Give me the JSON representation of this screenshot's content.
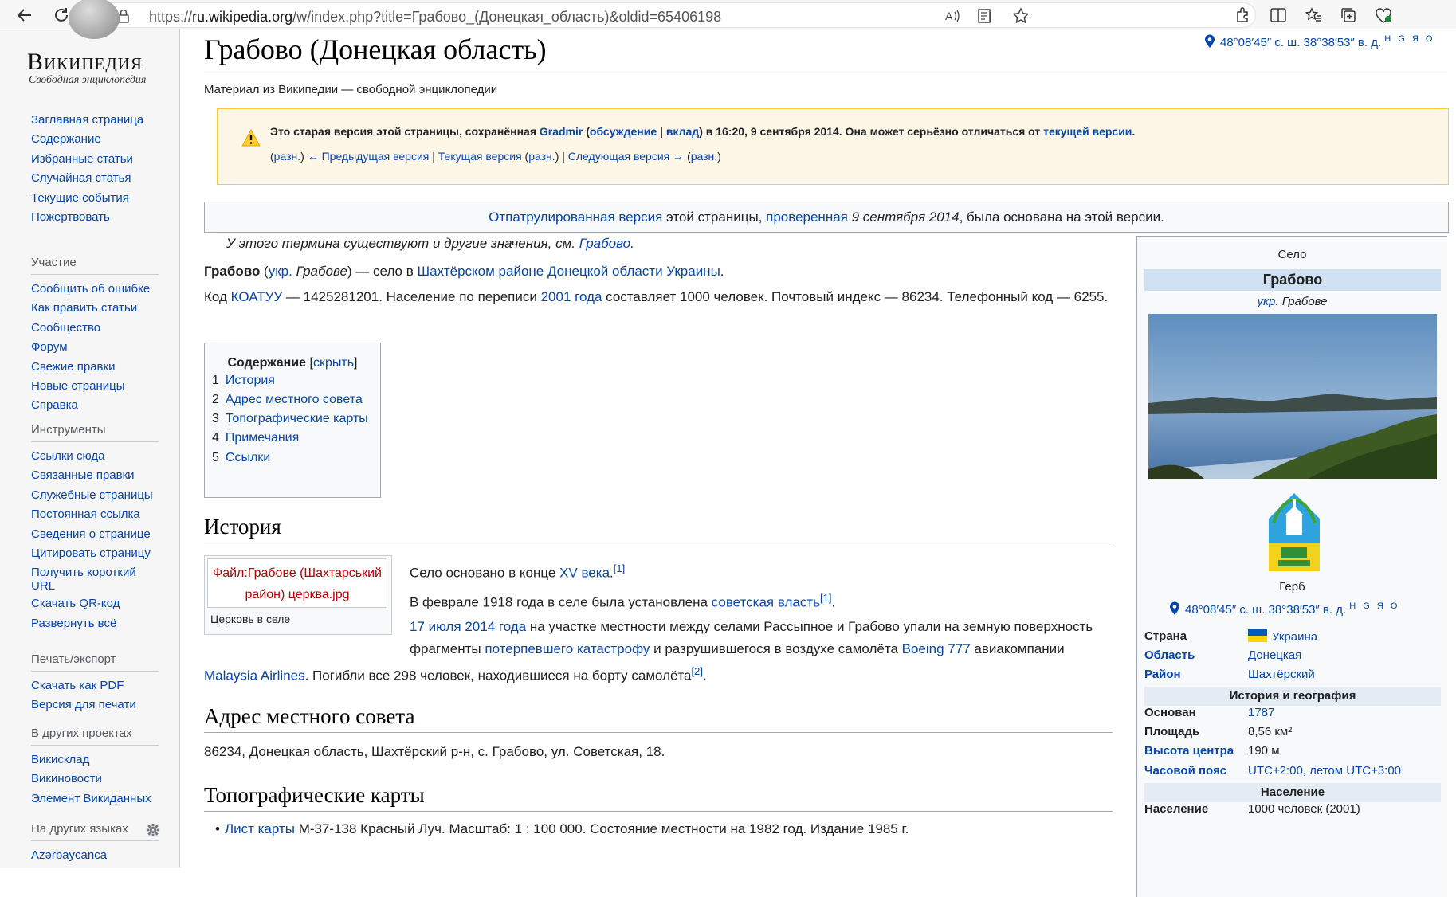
{
  "browser": {
    "url_prefix": "https://",
    "url_host": "ru.wikipedia.org",
    "url_rest": "/w/index.php?title=Грабово_(Донецкая_область)&oldid=65406198"
  },
  "logo": {
    "wordmark": "Википедия",
    "tagline": "Свободная энциклопедия"
  },
  "sidebar": {
    "main": [
      "Заглавная страница",
      "Содержание",
      "Избранные статьи",
      "Случайная статья",
      "Текущие события",
      "Пожертвовать"
    ],
    "participation": {
      "heading": "Участие",
      "items": [
        "Сообщить об ошибке",
        "Как править статьи",
        "Сообщество",
        "Форум",
        "Свежие правки",
        "Новые страницы",
        "Справка"
      ]
    },
    "tools": {
      "heading": "Инструменты",
      "items": [
        "Ссылки сюда",
        "Связанные правки",
        "Служебные страницы",
        "Постоянная ссылка",
        "Сведения о странице",
        "Цитировать страницу",
        "Получить короткий URL",
        "Скачать QR-код",
        "Развернуть всё"
      ]
    },
    "print": {
      "heading": "Печать/экспорт",
      "items": [
        "Скачать как PDF",
        "Версия для печати"
      ]
    },
    "projects": {
      "heading": "В других проектах",
      "items": [
        "Викисклад",
        "Викиновости",
        "Элемент Викиданных"
      ]
    },
    "languages": {
      "heading": "На других языках",
      "items": [
        "Azərbaycanca"
      ]
    }
  },
  "article": {
    "title": "Грабово (Донецкая область)",
    "sitesub": "Материал из Википедии — свободной энциклопедии",
    "coords": "48°08′45″ с. ш. 38°38′53″ в. д.",
    "coords_links": "H G Я O",
    "oldrev": {
      "t1": "Это старая версия этой страницы, сохранённая ",
      "user": "Gradmir",
      "t2": " (",
      "talk": "обсуждение",
      "sep": " | ",
      "contribs": "вклад",
      "t3": ") в 16:20, 9 сентября 2014. Она может серьёзно отличаться от ",
      "current": "текущей версии",
      "t4": ".",
      "nav": {
        "p_open": "(",
        "diff1": "разн.",
        "p_close": ") ",
        "prev": "← Предыдущая версия",
        "bar1": " | ",
        "cur": "Текущая версия",
        "p_open2": " (",
        "diff2": "разн.",
        "p_close2": ") | ",
        "next": "Следующая версия →",
        "p_open3": " (",
        "diff3": "разн.",
        "p_close3": ")"
      }
    },
    "patrol": {
      "link1": "Отпатрулированная версия",
      "t1": " этой страницы, ",
      "link2": "проверенная",
      "date": " 9 сентября 2014",
      "t2": ", была основана на этой версии."
    },
    "hatnote": {
      "t": "У этого термина существуют и другие значения, см. ",
      "link": "Грабово",
      "end": "."
    },
    "intro": {
      "bold": "Грабово",
      "t1": " (",
      "ukr": "укр.",
      "ukrname": " Грабове",
      "t2": ") — село в ",
      "link": "Шахтёрском районе Донецкой области Украины",
      "t3": "."
    },
    "intro2": {
      "t1": "Код ",
      "koatuu": "КОАТУУ",
      "t2": " — 1425281201. Население по переписи ",
      "year": "2001 года",
      "t3": " составляет 1000 человек. Почтовый индекс — 86234. Телефонный код — 6255."
    },
    "toc": {
      "title": "Содержание",
      "hide_open": " [",
      "hide": "скрыть",
      "hide_close": "]",
      "items": [
        {
          "num": "1",
          "label": "История"
        },
        {
          "num": "2",
          "label": "Адрес местного совета"
        },
        {
          "num": "3",
          "label": "Топографические карты"
        },
        {
          "num": "4",
          "label": "Примечания"
        },
        {
          "num": "5",
          "label": "Ссылки"
        }
      ]
    },
    "history": {
      "heading": "История",
      "thumb_link": "Файл:Грабове (Шахтарський район) церква.jpg",
      "thumb_caption": "Церковь в селе",
      "s1a": "Село основано в конце ",
      "s1link": "XV века",
      "s1end": ".",
      "ref1": "[1]",
      "s2a": "В феврале 1918 года в селе была установлена ",
      "s2link": "советская власть",
      "ref1b": "[1]",
      "s2end": ".",
      "s3date": "17 июля 2014 года",
      "s3a": " на участке местности между селами Рассыпное и Грабово упали на земную поверхность",
      "s3b": "фрагменты ",
      "s3link": "потерпевшего катастрофу",
      "s3c": " и разрушившегося в воздухе самолёта ",
      "boeing": "Boeing 777",
      "s3d": " авиакомпании",
      "malaysia": "Malaysia Airlines",
      "s3e": ". Погибли все 298 человек, находившиеся на борту самолёта",
      "ref2": "[2]",
      "s3end": "."
    },
    "council": {
      "heading": "Адрес местного совета",
      "text": "86234, Донецкая область, Шахтёрский р-н, с. Грабово, ул. Советская, 18."
    },
    "maps": {
      "heading": "Топографические карты",
      "bullet": "•",
      "link": "Лист карты",
      "text": " M-37-138 Красный Луч. Масштаб: 1 : 100 000. Состояние местности на 1982 год. Издание 1985 г."
    }
  },
  "infobox": {
    "above": "Село",
    "name": "Грабово",
    "native_prefix": "укр.",
    "native_name": " Грабове",
    "coa_caption": "Герб",
    "coords": "48°08′45″ с. ш. 38°38′53″ в. д.",
    "coords_links": "H G Я O",
    "rows1": [
      {
        "k": "Страна",
        "v": "Украина"
      },
      {
        "k": "Область",
        "v": "Донецкая"
      },
      {
        "k": "Район",
        "v": "Шахтёрский"
      }
    ],
    "sec1": "История и география",
    "rows2": [
      {
        "k": "Основан",
        "v": "1787"
      },
      {
        "k": "Площадь",
        "v": "8,56 км²"
      },
      {
        "k": "Высота центра",
        "v": "190 м"
      },
      {
        "k": "Часовой пояс",
        "v": "UTC+2:00, летом UTC+3:00"
      }
    ],
    "sec2": "Население",
    "rows3": [
      {
        "k": "Население",
        "v": "1000 человек (2001)"
      }
    ]
  },
  "colors": {
    "link": "#0645ad",
    "new_link": "#ba0000",
    "infobox_header": "#cee0f2",
    "warning_bg": "#fef6e7"
  }
}
